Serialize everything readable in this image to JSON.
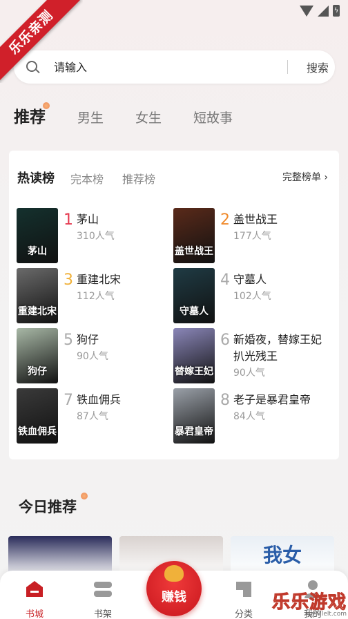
{
  "ribbon": {
    "text": "乐乐亲测"
  },
  "search": {
    "placeholder": "请输入",
    "button": "搜索"
  },
  "tabs": [
    {
      "label": "推荐",
      "active": true
    },
    {
      "label": "男生",
      "active": false
    },
    {
      "label": "女生",
      "active": false
    },
    {
      "label": "短故事",
      "active": false
    }
  ],
  "ranking": {
    "tabs": [
      {
        "label": "热读榜",
        "active": true
      },
      {
        "label": "完本榜",
        "active": false
      },
      {
        "label": "推荐榜",
        "active": false
      }
    ],
    "full_list": "完整榜单 ›",
    "books": [
      {
        "rank": "1",
        "title": "茅山",
        "popularity": "310人气",
        "rank_color": "#e5394f",
        "cover_text": "茅山",
        "cover_bg": "#14312e"
      },
      {
        "rank": "2",
        "title": "盖世战王",
        "popularity": "177人气",
        "rank_color": "#f08a2c",
        "cover_text": "盖世战王",
        "cover_bg": "#5a2a1a"
      },
      {
        "rank": "3",
        "title": "重建北宋",
        "popularity": "112人气",
        "rank_color": "#f0b13a",
        "cover_text": "重建北宋",
        "cover_bg": "#6a6a6a"
      },
      {
        "rank": "4",
        "title": "守墓人",
        "popularity": "102人气",
        "rank_color": "#aaaaaa",
        "cover_text": "守墓人",
        "cover_bg": "#1f3b44"
      },
      {
        "rank": "5",
        "title": "狗仔",
        "popularity": "90人气",
        "rank_color": "#aaaaaa",
        "cover_text": "狗仔",
        "cover_bg": "#a8b8a6"
      },
      {
        "rank": "6",
        "title": "新婚夜，替嫁王妃扒光残王",
        "popularity": "90人气",
        "rank_color": "#aaaaaa",
        "cover_text": "替嫁王妃",
        "cover_bg": "#8a86b8"
      },
      {
        "rank": "7",
        "title": "铁血佣兵",
        "popularity": "87人气",
        "rank_color": "#aaaaaa",
        "cover_text": "铁血佣兵",
        "cover_bg": "#3a3a3a"
      },
      {
        "rank": "8",
        "title": "老子是暴君皇帝",
        "popularity": "84人气",
        "rank_color": "#aaaaaa",
        "cover_text": "暴君皇帝",
        "cover_bg": "#9aa0a8"
      }
    ]
  },
  "today": {
    "title": "今日推荐",
    "card_colors": [
      "#2a2c5a",
      "#d9d2cf",
      "#e9eff5"
    ],
    "card_texts": [
      "",
      "",
      "我女"
    ]
  },
  "nav": [
    {
      "label": "书城",
      "active": true
    },
    {
      "label": "书架",
      "active": false
    },
    {
      "label": "赚钱",
      "active": false
    },
    {
      "label": "分类",
      "active": false
    },
    {
      "label": "我的",
      "active": false
    }
  ],
  "watermark": {
    "text": "乐乐游戏",
    "url": "www.lelt.com"
  },
  "colors": {
    "accent": "#c81f24"
  }
}
